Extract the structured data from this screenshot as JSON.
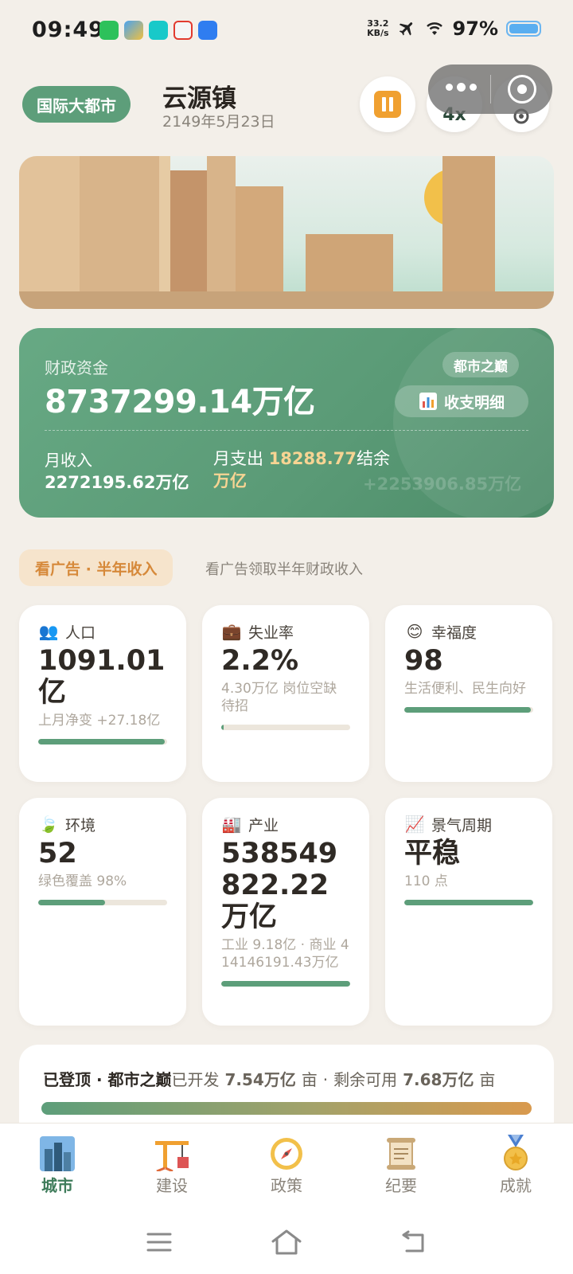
{
  "status_bar": {
    "time": "09:49",
    "net_speed_value": "33.2",
    "net_speed_unit": "KB/s",
    "battery": "97%"
  },
  "header": {
    "tier_badge": "国际大都市",
    "city_name": "云源镇",
    "date": "2149年5月23日",
    "speed_label": "4x",
    "icons": [
      "pause-icon",
      "gear-icon",
      "more-icon",
      "target-icon"
    ]
  },
  "finance": {
    "label": "财政资金",
    "amount": "8737299.14万亿",
    "peak_badge": "都市之巅",
    "detail_button": "收支明细",
    "income_label": "月收入",
    "income_value": "2272195.62万亿",
    "expense_label": "月支出",
    "expense_value": "18288.77",
    "balance_label": "结余",
    "balance_unit": "万亿",
    "net_value": "+2253906.85万亿"
  },
  "ad": {
    "button": "看广告 · 半年收入",
    "text": "看广告领取半年财政收入"
  },
  "stats": [
    {
      "icon": "people-icon",
      "label": "人口",
      "value": "1091.01亿",
      "sub": "上月净变 +27.18亿",
      "progress": 0.98
    },
    {
      "icon": "briefcase-icon",
      "label": "失业率",
      "value": "2.2%",
      "sub": "4.30万亿 岗位空缺待招",
      "progress": 0.02
    },
    {
      "icon": "smile-icon",
      "label": "幸福度",
      "value": "98",
      "sub": "生活便利、民生向好",
      "progress": 0.98
    },
    {
      "icon": "leaf-icon",
      "label": "环境",
      "value": "52",
      "sub": "绿色覆盖 98%",
      "progress": 0.52
    },
    {
      "icon": "factory-icon",
      "label": "产业",
      "value": "538549822.22万亿",
      "sub": "工业 9.18亿 · 商业 414146191.43万亿",
      "progress": 1.0
    },
    {
      "icon": "chart-up-icon",
      "label": "景气周期",
      "value": "平稳",
      "sub": "110 点",
      "progress": 1.0
    }
  ],
  "land": {
    "status": "已登顶 · 都市之巅",
    "developed_label": "已开发",
    "developed_value": "7.54万亿",
    "unit": "亩",
    "separator": "·",
    "remaining_label": "剩余可用",
    "remaining_value": "7.68万亿",
    "progress": 1.0
  },
  "tabs": [
    {
      "label": "城市",
      "icon": "city-icon",
      "active": true
    },
    {
      "label": "建设",
      "icon": "crane-icon",
      "active": false
    },
    {
      "label": "政策",
      "icon": "compass-icon",
      "active": false
    },
    {
      "label": "纪要",
      "icon": "scroll-icon",
      "active": false
    },
    {
      "label": "成就",
      "icon": "medal-icon",
      "active": false
    }
  ],
  "colors": {
    "accent_green": "#5d9e7a",
    "accent_orange": "#f0a030",
    "background": "#f3efe9"
  }
}
